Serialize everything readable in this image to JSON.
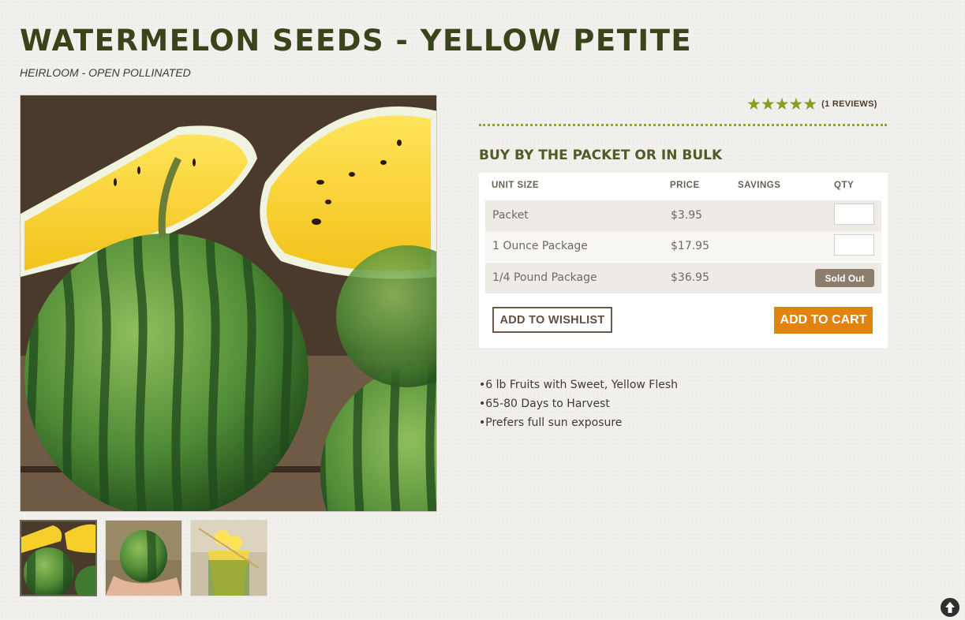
{
  "product": {
    "title": "WATERMELON SEEDS - YELLOW PETITE",
    "subtitle": "HEIRLOOM - OPEN POLLINATED"
  },
  "rating": {
    "stars_value": 5,
    "stars_max": 5,
    "reviews_label": "(1 REVIEWS)"
  },
  "purchase": {
    "heading": "BUY BY THE PACKET OR IN BULK",
    "columns": {
      "unit_size": "UNIT SIZE",
      "price": "PRICE",
      "savings": "SAVINGS",
      "qty": "QTY"
    },
    "rows": [
      {
        "unit": "Packet",
        "price": "$3.95",
        "savings": "",
        "qty": "",
        "sold_out": false
      },
      {
        "unit": "1 Ounce Package",
        "price": "$17.95",
        "savings": "",
        "qty": "",
        "sold_out": false
      },
      {
        "unit": "1/4 Pound Package",
        "price": "$36.95",
        "savings": "",
        "sold_out": true,
        "sold_out_label": "Sold Out"
      }
    ],
    "wishlist_label": "ADD TO WISHLIST",
    "cart_label": "ADD TO CART"
  },
  "features": [
    "6 lb Fruits with Sweet, Yellow Flesh",
    "65-80 Days to Harvest",
    "Prefers full sun exposure"
  ],
  "icons": {
    "back_to_top": "arrow-up-circle-icon",
    "star": "star-icon"
  },
  "colors": {
    "title": "#39441a",
    "accent_green": "#84a01e",
    "cart_orange": "#e28310",
    "sold_out": "#8c7e6c"
  }
}
